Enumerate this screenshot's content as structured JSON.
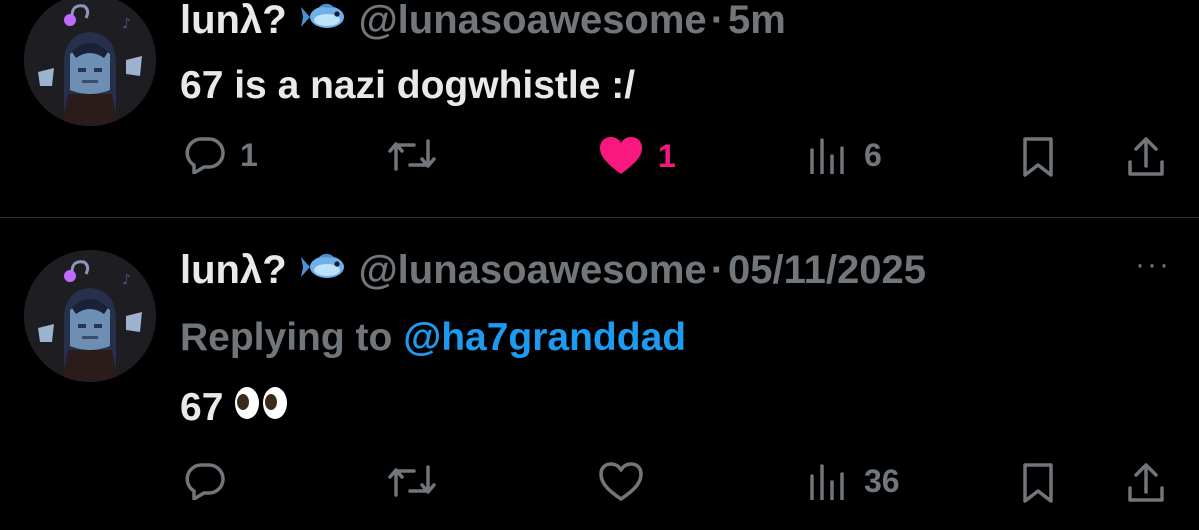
{
  "tweets": [
    {
      "display_name": "lunλ?",
      "handle": "@lunasoawesome",
      "separator": "·",
      "time": "5m",
      "text": "67 is a nazi dogwhistle :/",
      "reply_count": "1",
      "retweet_count": "",
      "like_count": "1",
      "liked": true,
      "view_count": "6"
    },
    {
      "display_name": "lunλ?",
      "handle": "@lunasoawesome",
      "separator": "·",
      "time": "05/11/2025",
      "replying_prefix": "Replying to",
      "replying_to": "@ha7granddad",
      "text": "67",
      "emoji": "eyes",
      "reply_count": "",
      "retweet_count": "",
      "like_count": "",
      "liked": false,
      "view_count": "36",
      "more_label": "···"
    }
  ],
  "colors": {
    "background": "#000000",
    "text": "#e7e9ea",
    "muted": "#71767b",
    "link": "#1d9bf0",
    "like": "#f91880",
    "divider": "#2f3336"
  },
  "icons": [
    "avatar",
    "fish-emoji",
    "reply-icon",
    "retweet-icon",
    "heart-icon",
    "views-icon",
    "bookmark-icon",
    "share-icon",
    "more-icon",
    "eyes-emoji"
  ]
}
